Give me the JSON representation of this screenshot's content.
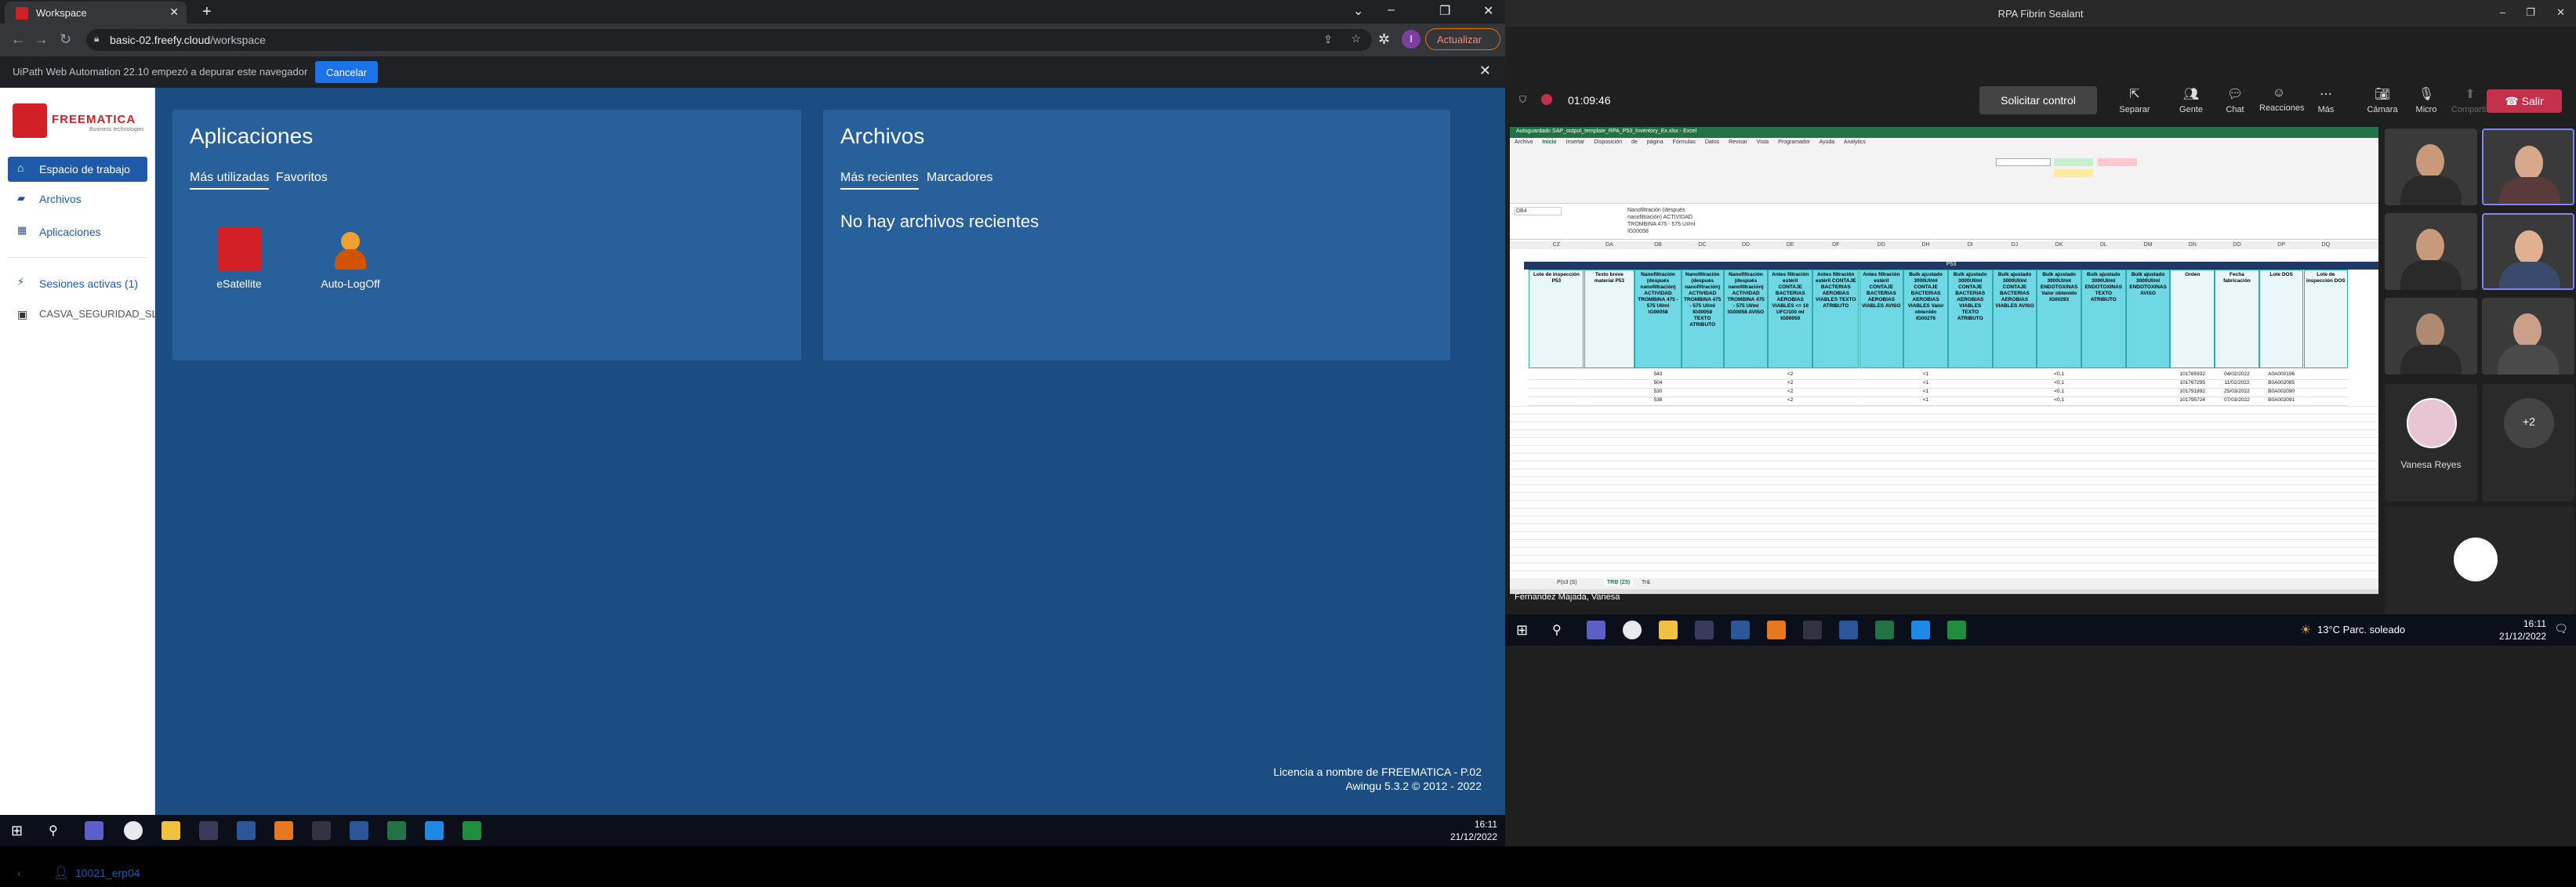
{
  "browser": {
    "tab_title": "Workspace",
    "url_host": "basic-02.freefy.cloud",
    "url_path": "/workspace",
    "update_label": "Actualizar",
    "avatar_letter": "I"
  },
  "infobar": {
    "message": "UiPath Web Automation 22.10 empezó a depurar este navegador",
    "cancel_label": "Cancelar"
  },
  "sidebar": {
    "logo_text": "FREEMATICA",
    "logo_sub": "Business technologies",
    "items": [
      {
        "label": "Espacio de trabajo",
        "icon": "home-icon"
      },
      {
        "label": "Archivos",
        "icon": "folder-icon"
      },
      {
        "label": "Aplicaciones",
        "icon": "grid-icon"
      },
      {
        "label": "Sesiones activas (1)",
        "icon": "sessions-icon"
      },
      {
        "label": "CASVA_SEGURIDAD_SL",
        "icon": "company-icon"
      }
    ],
    "user_label": "10021_erp04"
  },
  "apps_card": {
    "title": "Aplicaciones",
    "tabs": [
      "Más utilizadas",
      "Favoritos"
    ],
    "apps": [
      {
        "label": "eSatellite",
        "color": "#d32027"
      },
      {
        "label": "Auto-LogOff",
        "color": "#e87722"
      }
    ]
  },
  "files_card": {
    "title": "Archivos",
    "tabs": [
      "Más recientes",
      "Marcadores"
    ],
    "empty_message": "No hay archivos recientes"
  },
  "license": {
    "line1": "Licencia a nombre de FREEMATICA - P.02",
    "line2": "Awingu 5.3.2 © 2012 - 2022"
  },
  "taskbar": {
    "time": "16:11",
    "date": "21/12/2022",
    "weather": "13°C  Parc. soleado"
  },
  "meeting": {
    "title": "RPA Fibrin Sealant",
    "timer": "01:09:46",
    "request_control": "Solicitar control",
    "buttons": [
      "Separar",
      "Gente",
      "Chat",
      "Reacciones",
      "Más",
      "Cámara",
      "Micro",
      "Compartir"
    ],
    "leave": "Salir",
    "participant_name": "Vanesa Reyes",
    "extra_count": "+2",
    "screen_sharer": "Fernandez Majada, Vanesa"
  },
  "excel": {
    "title": "Autoguardado  SAP_output_template_RPA_P53_Inventory_Ex.xlsx - Excel",
    "ribbon_tabs": [
      "Archivo",
      "Inicio",
      "Insertar",
      "Disposición de página",
      "Fórmulas",
      "Datos",
      "Revisar",
      "Vista",
      "Programador",
      "Ayuda",
      "Analytics"
    ],
    "cell_ref": "DB4",
    "formula": "Nanofiltración (después nanofiltración) ACTIVIDAD TROMBINA 475 - 575 UI/ml IG00058",
    "band_label": "P53",
    "columns": [
      "CZ",
      "DA",
      "DB",
      "DC",
      "DD",
      "DE",
      "DF",
      "DG",
      "DH",
      "DI",
      "DJ",
      "DK",
      "DL",
      "DM",
      "DN",
      "DO",
      "DP",
      "DQ"
    ],
    "headers": [
      "Lote de inspección P53",
      "Texto breve material P53",
      "Nanofiltración (después nanofiltración) ACTIVIDAD TROMBINA 475 - 575 UI/ml IG00058",
      "Nanofiltración (después nanofiltración) ACTIVIDAD TROMBINA 475 - 575 UI/ml IG00058 TEXTO ATRIBUTO",
      "Nanofiltración (después nanofiltración) ACTIVIDAD TROMBINA 475 - 575 UI/ml IG00058 AVISO",
      "Antes filtración estéril CONTAJE BACTERIAS AEROBIAS VIABLES <= 10 UFC/100 ml IG00059",
      "Antes filtración estéril CONTAJE BACTERIAS AEROBIAS VIABLES TEXTO ATRIBUTO",
      "Antes filtración estéril CONTAJE BACTERIAS AEROBIAS VIABLES AVISO",
      "Bulk ajustado 3000UI/ml CONTAJE BACTERIAS AEROBIAS VIABLES Valor obtenido IG00276",
      "Bulk ajustado 3000UI/ml CONTAJE BACTERIAS AEROBIAS VIABLES TEXTO ATRIBUTO",
      "Bulk ajustado 3000UI/ml CONTAJE BACTERIAS AEROBIAS VIABLES AVISO",
      "Bulk ajustado 3000UI/ml ENDOTOXINAS Valor obtenido IG00293",
      "Bulk ajustado 3000UI/ml ENDOTOXINAS TEXTO ATRIBUTO",
      "Bulk ajustado 3000UI/ml ENDOTOXINAS AVISO",
      "Orden",
      "Fecha fabricación",
      "Lote DOS",
      "Lote de inspección DOS"
    ],
    "rows": [
      [
        "",
        "",
        "543",
        "",
        "",
        "<2",
        "",
        "",
        "<1",
        "",
        "",
        "<0,1",
        "",
        "",
        "101765932",
        "04/02/2022",
        "A0A000196",
        ""
      ],
      [
        "",
        "",
        "504",
        "",
        "",
        "<2",
        "",
        "",
        "<1",
        "",
        "",
        "<0,1",
        "",
        "",
        "101767295",
        "11/02/2022",
        "B0A002085",
        ""
      ],
      [
        "",
        "",
        "530",
        "",
        "",
        "<2",
        "",
        "",
        "<1",
        "",
        "",
        "<0,1",
        "",
        "",
        "101791892",
        "25/03/2022",
        "B0A002090",
        ""
      ],
      [
        "",
        "",
        "538",
        "",
        "",
        "<2",
        "",
        "",
        "<1",
        "",
        "",
        "<0,1",
        "",
        "",
        "101795724",
        "07/03/2022",
        "B0A002091",
        ""
      ]
    ],
    "sheets": [
      "P(s3 (S)",
      "TRB (Z5)",
      "Tr&"
    ]
  }
}
